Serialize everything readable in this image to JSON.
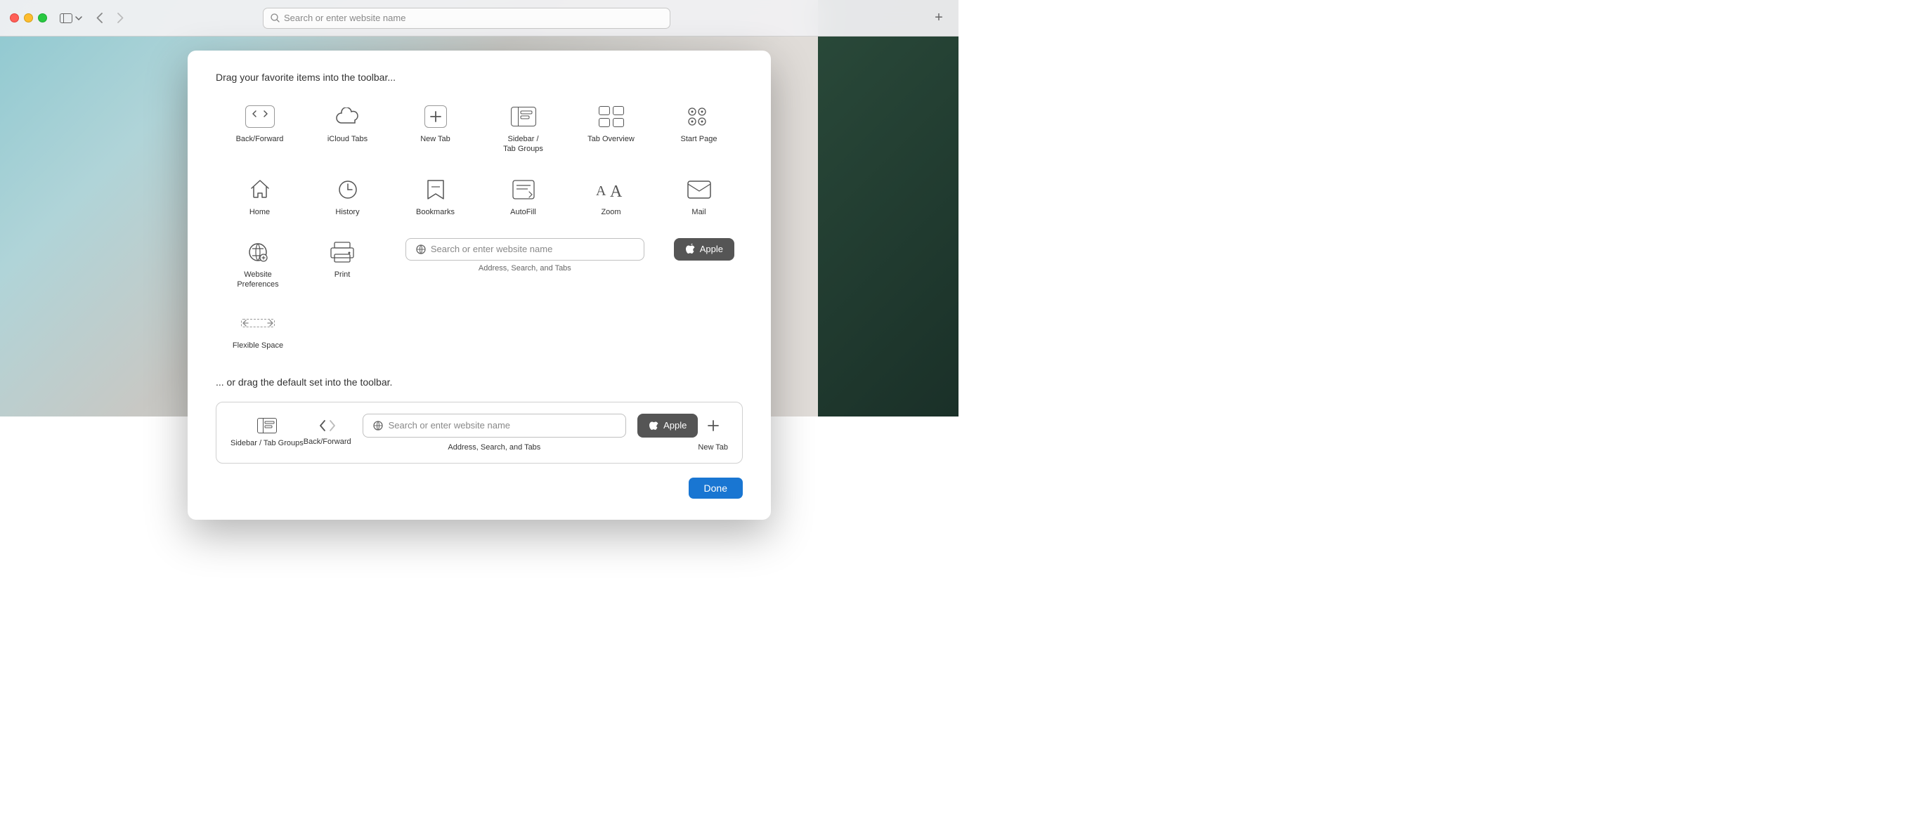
{
  "titlebar": {
    "search_placeholder": "Search or enter website name",
    "add_label": "+"
  },
  "dialog": {
    "drag_title": "Drag your favorite items into the toolbar...",
    "default_title": "... or drag the default set into the toolbar.",
    "done_label": "Done"
  },
  "toolbar_items": [
    {
      "id": "back-forward",
      "label": "Back/Forward",
      "icon": "back-forward"
    },
    {
      "id": "icloud-tabs",
      "label": "iCloud Tabs",
      "icon": "icloud"
    },
    {
      "id": "new-tab",
      "label": "New Tab",
      "icon": "plus"
    },
    {
      "id": "sidebar-tab-groups",
      "label": "Sidebar /\nTab Groups",
      "icon": "sidebar"
    },
    {
      "id": "tab-overview",
      "label": "Tab Overview",
      "icon": "tab-overview"
    },
    {
      "id": "start-page",
      "label": "Start Page",
      "icon": "grid"
    },
    {
      "id": "home",
      "label": "Home",
      "icon": "home"
    },
    {
      "id": "history",
      "label": "History",
      "icon": "history"
    },
    {
      "id": "bookmarks",
      "label": "Bookmarks",
      "icon": "bookmarks"
    },
    {
      "id": "autofill",
      "label": "AutoFill",
      "icon": "autofill"
    },
    {
      "id": "zoom",
      "label": "Zoom",
      "icon": "zoom"
    },
    {
      "id": "mail",
      "label": "Mail",
      "icon": "mail"
    },
    {
      "id": "website-preferences",
      "label": "Website\nPreferences",
      "icon": "website-prefs"
    },
    {
      "id": "print",
      "label": "Print",
      "icon": "print"
    },
    {
      "id": "flexible-space",
      "label": "Flexible Space",
      "icon": "flexible-space"
    }
  ],
  "search_pill": {
    "placeholder": "Search or enter website name",
    "sublabel": "Address, Search, and Tabs"
  },
  "apple_button": {
    "label": "Apple"
  },
  "default_toolbar": {
    "items": [
      {
        "id": "sidebar-tab-groups",
        "label": "Sidebar / Tab Groups",
        "icon": "sidebar"
      },
      {
        "id": "back-forward",
        "label": "Back/Forward",
        "icon": "back-forward-nav"
      },
      {
        "id": "address-bar",
        "label": "Address, Search, and Tabs",
        "placeholder": "Search or enter website name"
      },
      {
        "id": "apple",
        "label": "Apple"
      },
      {
        "id": "new-tab",
        "label": "New Tab",
        "icon": "plus"
      }
    ]
  }
}
